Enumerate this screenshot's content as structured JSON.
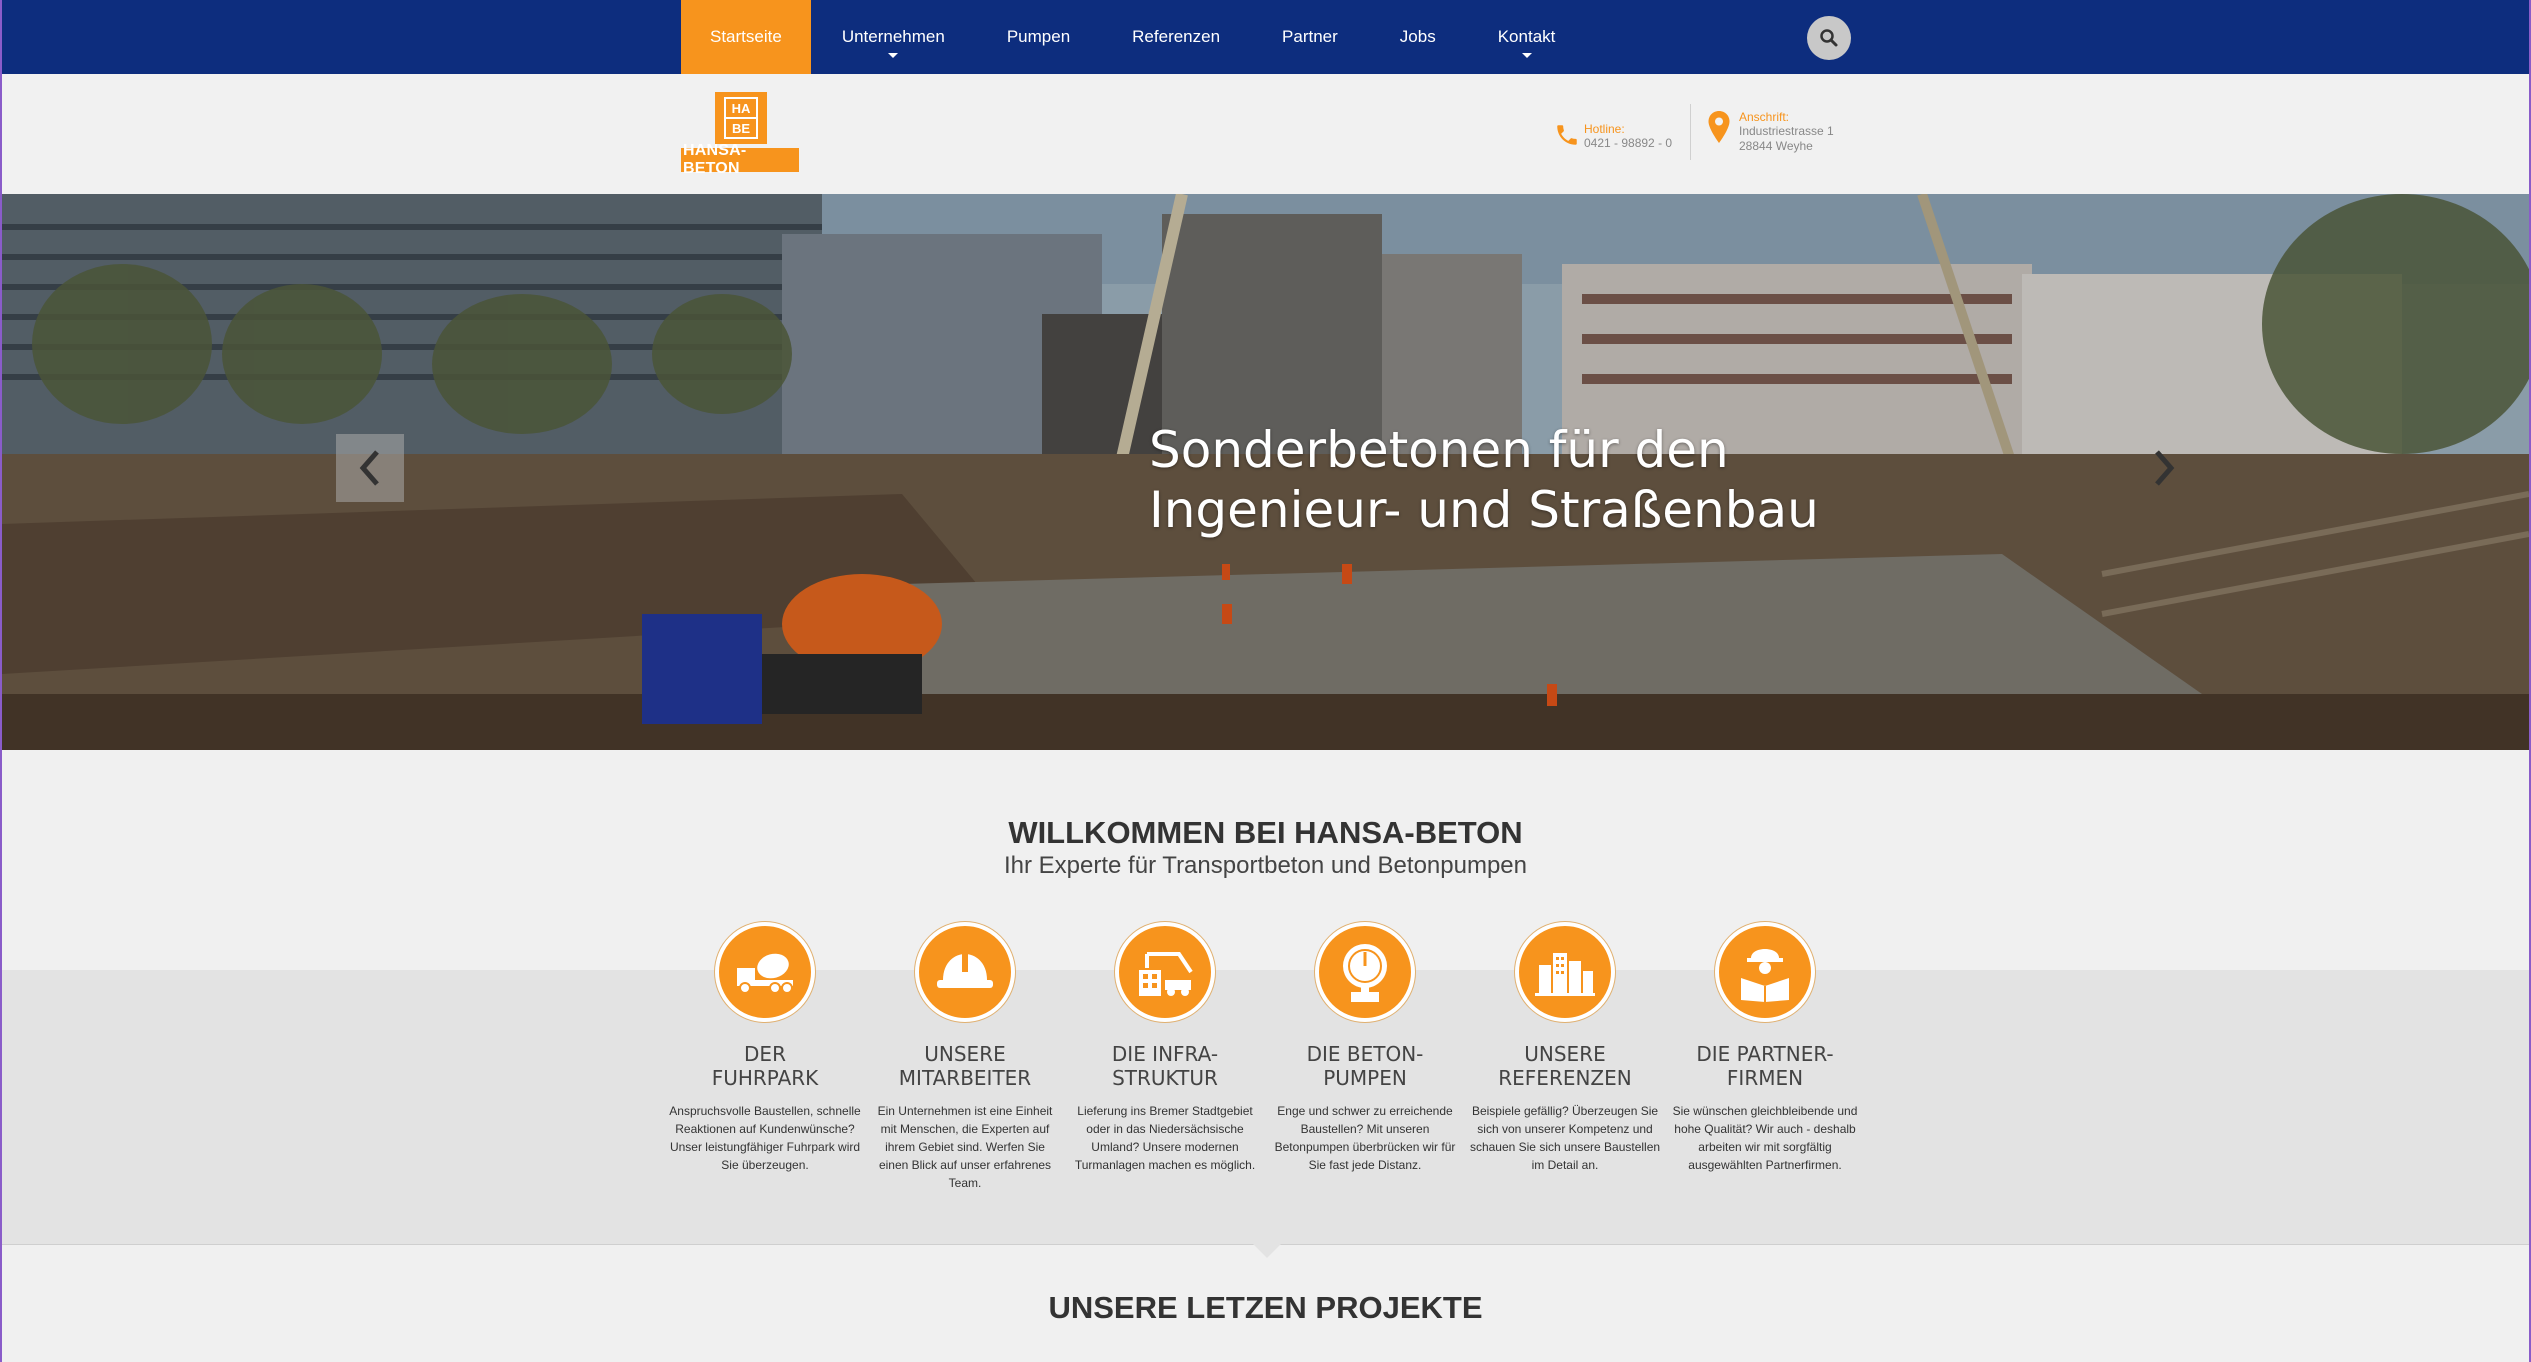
{
  "nav": {
    "items": [
      {
        "label": "Startseite",
        "active": true,
        "dropdown": false
      },
      {
        "label": "Unternehmen",
        "active": false,
        "dropdown": true
      },
      {
        "label": "Pumpen",
        "active": false,
        "dropdown": false
      },
      {
        "label": "Referenzen",
        "active": false,
        "dropdown": false
      },
      {
        "label": "Partner",
        "active": false,
        "dropdown": false
      },
      {
        "label": "Jobs",
        "active": false,
        "dropdown": false
      },
      {
        "label": "Kontakt",
        "active": false,
        "dropdown": true
      }
    ],
    "search_icon": "search-icon"
  },
  "header": {
    "logo_mark": [
      "HA",
      "BE"
    ],
    "logo_text": "HANSA-BETON",
    "hotline_label": "Hotline:",
    "hotline_value": "0421 - 98892 - 0",
    "address_label": "Anschrift:",
    "address_line1": "Industriestrasse 1",
    "address_line2": "28844 Weyhe"
  },
  "hero": {
    "title_line1": "Sonderbetonen für den",
    "title_line2": "Ingenieur- und Straßenbau"
  },
  "welcome": {
    "title": "WILLKOMMEN BEI HANSA-BETON",
    "subtitle": "Ihr Experte für Transportbeton und Betonpumpen"
  },
  "features": [
    {
      "icon": "truck-mixer-icon",
      "title1": "DER",
      "title2": "FUHRPARK",
      "text": "Anspruchsvolle Baustellen, schnelle Reaktionen auf Kundenwünsche? Unser leistungfähiger Fuhrpark wird Sie überzeugen."
    },
    {
      "icon": "hard-hat-icon",
      "title1": "UNSERE",
      "title2": "MITARBEITER",
      "text": "Ein Unternehmen ist eine Einheit mit Menschen, die Experten auf ihrem Gebiet sind. Werfen Sie einen Blick auf unser erfahrenes Team."
    },
    {
      "icon": "crane-icon",
      "title1": "DIE INFRA-",
      "title2": "STRUKTUR",
      "text": "Lieferung ins Bremer Stadtgebiet oder in das Niedersächsische Umland? Unsere modernen Turmanlagen machen es möglich."
    },
    {
      "icon": "pressure-gauge-icon",
      "title1": "DIE BETON-",
      "title2": "PUMPEN",
      "text": "Enge und schwer zu erreichende Baustellen? Mit unseren Betonpumpen überbrücken wir für Sie fast jede Distanz."
    },
    {
      "icon": "city-buildings-icon",
      "title1": "UNSERE",
      "title2": "REFERENZEN",
      "text": "Beispiele gefällig? Überzeugen Sie sich von unserer Kompetenz und schauen Sie sich unsere Baustellen im Detail an."
    },
    {
      "icon": "worker-blueprint-icon",
      "title1": "DIE PARTNER-",
      "title2": "FIRMEN",
      "text": "Sie wünschen gleichbleibende und hohe Qualität? Wir auch - deshalb arbeiten wir mit sorgfältig ausgewählten Partnerfirmen."
    }
  ],
  "projects": {
    "title": "UNSERE LETZEN PROJEKTE"
  },
  "colors": {
    "nav_bg": "#0d2d7e",
    "accent": "#f7941d"
  }
}
